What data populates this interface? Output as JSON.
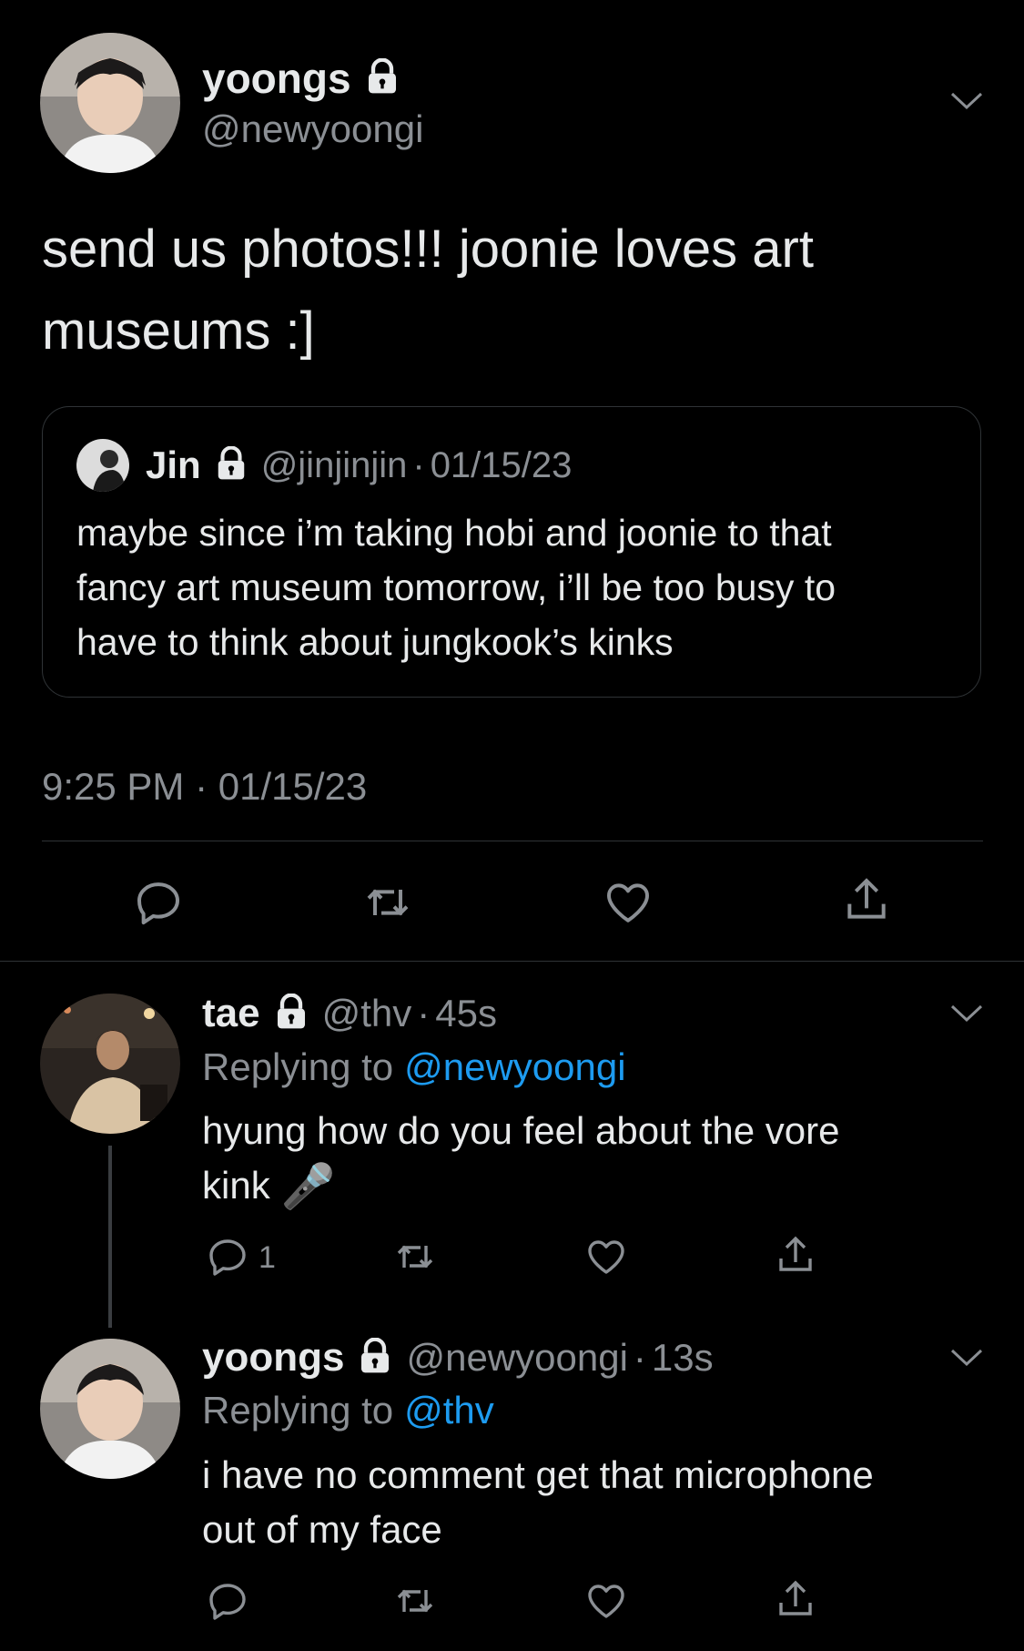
{
  "main_tweet": {
    "display_name": "yoongs",
    "handle": "@newyoongi",
    "text_line1": "send us photos!!! joonie loves art",
    "text_line2": "museums :]",
    "timestamp": "9:25 PM · 01/15/23"
  },
  "quoted_tweet": {
    "display_name": "Jin",
    "handle": "@jinjinjin",
    "date": "01/15/23",
    "text_line1": "maybe since i’m taking hobi and joonie to that",
    "text_line2": "fancy art museum tomorrow, i’ll be too busy to",
    "text_line3": "have to think about jungkook’s kinks"
  },
  "reply1": {
    "display_name": "tae",
    "handle": "@thv",
    "time": "45s",
    "replying_prefix": "Replying to",
    "replying_to": "@newyoongi",
    "text_line1": "hyung how do you feel about the vore",
    "text_line2": "kink",
    "emoji": "🎤",
    "reply_count": "1"
  },
  "reply2": {
    "display_name": "yoongs",
    "handle": "@newyoongi",
    "time": "13s",
    "replying_prefix": "Replying to",
    "replying_to": "@thv",
    "text_line1": "i have no comment get that microphone",
    "text_line2": "out of my face"
  },
  "separator": "·",
  "icons": [
    "lock-icon",
    "chevron-down-icon",
    "reply-icon",
    "retweet-icon",
    "like-icon",
    "share-icon"
  ],
  "colors": {
    "background": "#000000",
    "text": "#e7e9ea",
    "muted": "#8b8f94",
    "link": "#1d9bf0",
    "border": "#2f3336"
  }
}
